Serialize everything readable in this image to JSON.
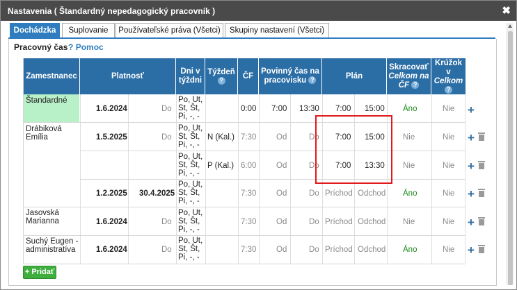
{
  "dialog": {
    "title": "Nastavenia ( Štandardný nepedagogický pracovník )",
    "close": "✖"
  },
  "tabs": [
    {
      "label": "Dochádzka"
    },
    {
      "label": "Suplovanie"
    },
    {
      "label": "Používateľské práva (Všetci)"
    },
    {
      "label": "Skupiny nastavení (Všetci)"
    }
  ],
  "section": {
    "title": "Pracovný čas",
    "help_q": "?",
    "help": "Pomoc"
  },
  "table": {
    "headers": {
      "employee": "Zamestnanec",
      "validity": "Platnosť",
      "days1": "Dni v",
      "days2": "týždni",
      "week": "Týždeň",
      "cf": "ČF",
      "req1": "Povinný čas na",
      "req2": "pracovisku",
      "plan": "Plán",
      "short1": "Skracovať",
      "short2": "Celkom na",
      "short3": "ČF",
      "circle1": "Krúžok",
      "circle2": "v",
      "circle3": "Celkom",
      "q": "?"
    },
    "days_text": [
      "Po, Ut,",
      "St, Št,",
      "Pi, -, -"
    ],
    "rows": [
      {
        "name1": "Štandardné",
        "name2": "",
        "from": "1.6.2024",
        "to": "Do",
        "week": "",
        "cf": "0:00",
        "req_from": "7:00",
        "req_to": "13:30",
        "plan_from": "7:00",
        "plan_to": "15:00",
        "short": "Áno",
        "circle": "Nie"
      },
      {
        "name1": "Drábiková",
        "name2": "Emília",
        "from": "1.5.2025",
        "to": "Do",
        "week": "N (Kal.)",
        "cf": "7:30",
        "req_from": "Od",
        "req_to": "Do",
        "plan_from": "7:00",
        "plan_to": "15:00",
        "short": "Nie",
        "circle": "Nie"
      },
      {
        "name1": "",
        "name2": "",
        "from": "",
        "to": "",
        "week": "P (Kal.)",
        "cf": "6:00",
        "req_from": "Od",
        "req_to": "Do",
        "plan_from": "7:00",
        "plan_to": "13:30",
        "short": "Nie",
        "circle": "Nie"
      },
      {
        "name1": "",
        "name2": "",
        "from": "1.2.2025",
        "to": "30.4.2025",
        "week": "",
        "cf": "7:30",
        "req_from": "Od",
        "req_to": "Do",
        "plan_from": "Príchod",
        "plan_to": "Odchod",
        "short": "Áno",
        "circle": "Nie"
      },
      {
        "name1": "Jasovská",
        "name2": "Marianna",
        "from": "1.6.2024",
        "to": "Do",
        "week": "",
        "cf": "7:30",
        "req_from": "Od",
        "req_to": "Do",
        "plan_from": "Príchod",
        "plan_to": "Odchod",
        "short": "Nie",
        "circle": "Nie"
      },
      {
        "name1": "Suchý Eugen -",
        "name2": "administratíva",
        "from": "1.6.2024",
        "to": "Do",
        "week": "",
        "cf": "7:30",
        "req_from": "Od",
        "req_to": "Do",
        "plan_from": "Príchod",
        "plan_to": "Odchod",
        "short": "Áno",
        "circle": "Nie"
      }
    ],
    "plus": "+"
  },
  "add_button": "+ Pridať",
  "colors": {
    "header": "#2b6da5",
    "accent": "#2f7dbf",
    "highlight": "#b8f0c8",
    "annotation": "#e01a1a",
    "yes": "#1a8a1a"
  }
}
